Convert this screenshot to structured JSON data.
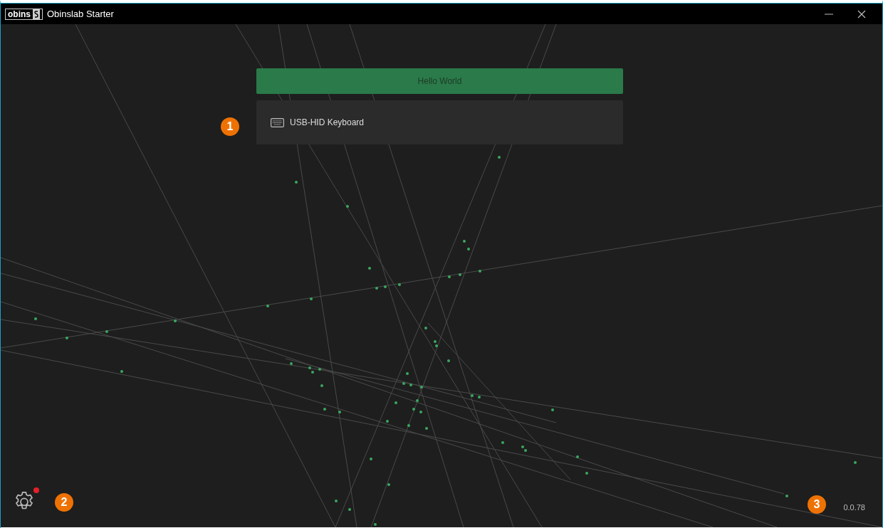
{
  "window": {
    "logo": "obins",
    "title": "Obinslab Starter"
  },
  "banner": {
    "label": "Hello World"
  },
  "devices": [
    {
      "kind": "keyboard",
      "name": "USB-HID Keyboard"
    }
  ],
  "settings": {
    "notification": true
  },
  "version": "0.0.78",
  "callouts": [
    "1",
    "2",
    "3"
  ]
}
